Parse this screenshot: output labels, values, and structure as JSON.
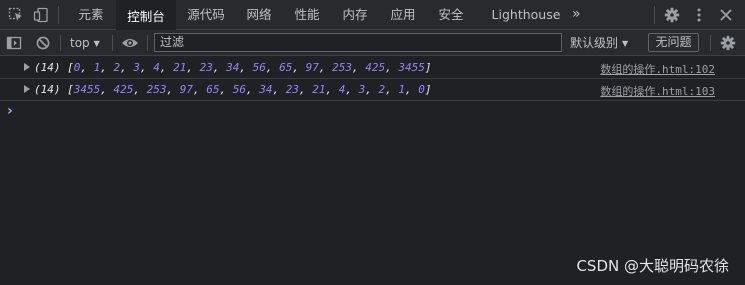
{
  "tabs": [
    {
      "label": "元素"
    },
    {
      "label": "控制台"
    },
    {
      "label": "源代码"
    },
    {
      "label": "网络"
    },
    {
      "label": "性能"
    },
    {
      "label": "内存"
    },
    {
      "label": "应用"
    },
    {
      "label": "安全"
    },
    {
      "label": "Lighthouse"
    }
  ],
  "active_tab": "控制台",
  "more_tabs_glyph": "»",
  "toolbar": {
    "context": "top",
    "filter_placeholder": "过滤",
    "levels": "默认级别",
    "issues": "无问题"
  },
  "console": {
    "rows": [
      {
        "prefix": "(14) [",
        "values": [
          "0",
          "1",
          "2",
          "3",
          "4",
          "21",
          "23",
          "34",
          "56",
          "65",
          "97",
          "253",
          "425",
          "3455"
        ],
        "suffix": "]",
        "source": "数组的操作.html:102"
      },
      {
        "prefix": "(14) [",
        "values": [
          "3455",
          "425",
          "253",
          "97",
          "65",
          "56",
          "34",
          "23",
          "21",
          "4",
          "3",
          "2",
          "1",
          "0"
        ],
        "suffix": "]",
        "source": "数组的操作.html:103"
      }
    ],
    "prompt": "›"
  },
  "watermark": "CSDN @大聪明码农徐",
  "colors": {
    "background": "#202124",
    "number": "#9980ff",
    "prompt": "#8ab4f8"
  }
}
